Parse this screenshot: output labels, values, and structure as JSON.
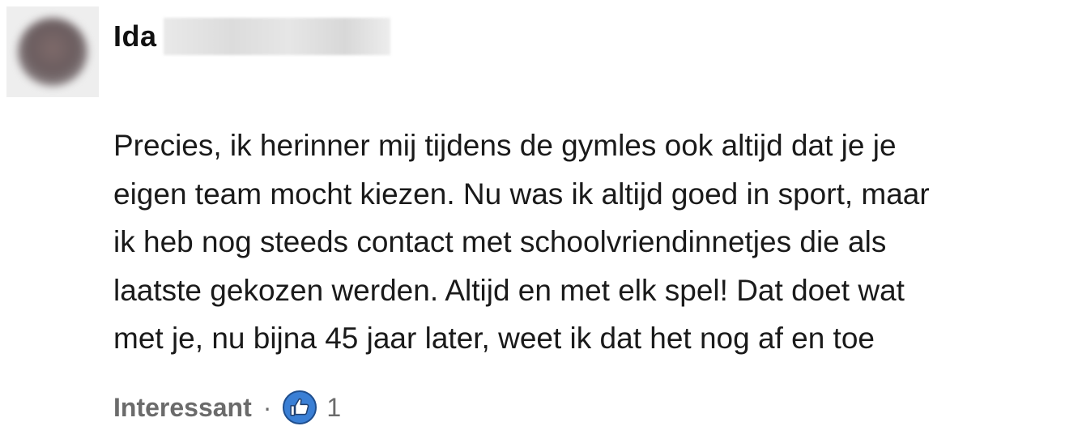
{
  "comment": {
    "author_first_name": "Ida",
    "body_lines": [
      "Precies, ik herinner mij tijdens de gymles ook altijd dat je je",
      "eigen team mocht kiezen. Nu was ik altijd goed in sport, maar",
      "ik heb nog steeds contact met schoolvriendinnetjes die als",
      "laatste gekozen werden. Altijd en met elk spel! Dat doet wat",
      "met je, nu bijna 45 jaar later, weet ik dat het nog af en toe"
    ],
    "reaction_label": "Interessant",
    "separator": "·",
    "reaction_icon": "thumbs-up-icon",
    "reaction_count": "1"
  },
  "colors": {
    "text": "#1a1a1a",
    "muted": "#6b6b6b",
    "like_blue": "#3a7fd5"
  }
}
